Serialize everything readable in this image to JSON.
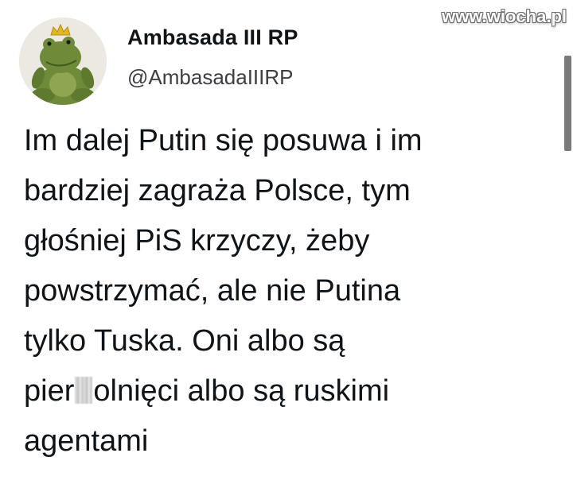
{
  "watermark": "www.wiocha.pl",
  "author": {
    "display_name": "Ambasada III RP",
    "handle": "@AmbasadaIIIRP",
    "avatar_icon": "frog-plush-avatar-icon"
  },
  "tweet": {
    "lines": [
      "Im dalej Putin się posuwa i im",
      "bardziej zagraża Polsce, tym",
      "głośniej PiS krzyczy, żeby",
      "powstrzymać, ale nie Putina",
      "tylko Tuska. Oni albo są"
    ],
    "line6_before": "pier",
    "line6_after": "olnięci albo są ruskimi",
    "line7": "agentami"
  },
  "colors": {
    "text": "#0f1419",
    "handle": "#3b3f44",
    "background": "#ffffff"
  }
}
